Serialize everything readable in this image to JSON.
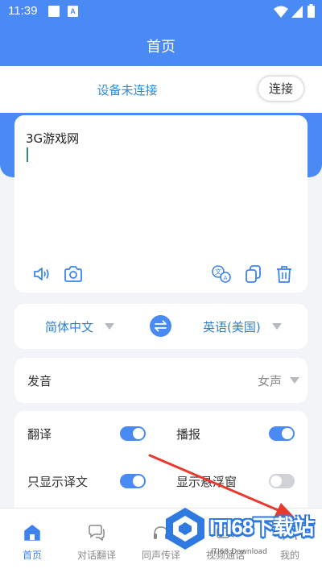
{
  "status_bar": {
    "time": "11:39",
    "a_badge": "A"
  },
  "header": {
    "title": "首页"
  },
  "connection": {
    "status": "设备未连接",
    "connect_label": "连接"
  },
  "input": {
    "text": "3G游戏网"
  },
  "languages": {
    "source": "简体中文",
    "target": "英语(美国)"
  },
  "voice": {
    "label": "发音",
    "value": "女声"
  },
  "options": [
    {
      "label": "翻译",
      "on": true
    },
    {
      "label": "播报",
      "on": true
    },
    {
      "label": "只显示译文",
      "on": true
    },
    {
      "label": "显示悬浮窗",
      "on": false
    }
  ],
  "tabs": [
    {
      "label": "首页",
      "icon": "home-icon",
      "active": true
    },
    {
      "label": "对话翻译",
      "icon": "chat-icon",
      "active": false
    },
    {
      "label": "同声传译",
      "icon": "simultaneous-icon",
      "active": false
    },
    {
      "label": "视频通话",
      "icon": "video-call-icon",
      "active": false
    },
    {
      "label": "我的",
      "icon": "profile-icon",
      "active": false
    }
  ],
  "watermark": {
    "brand": "ITI68下载站",
    "subtitle": "ITI68 Download"
  },
  "colors": {
    "primary": "#4a8af4",
    "link": "#2e7fd0",
    "arrow": "#e8392e"
  }
}
